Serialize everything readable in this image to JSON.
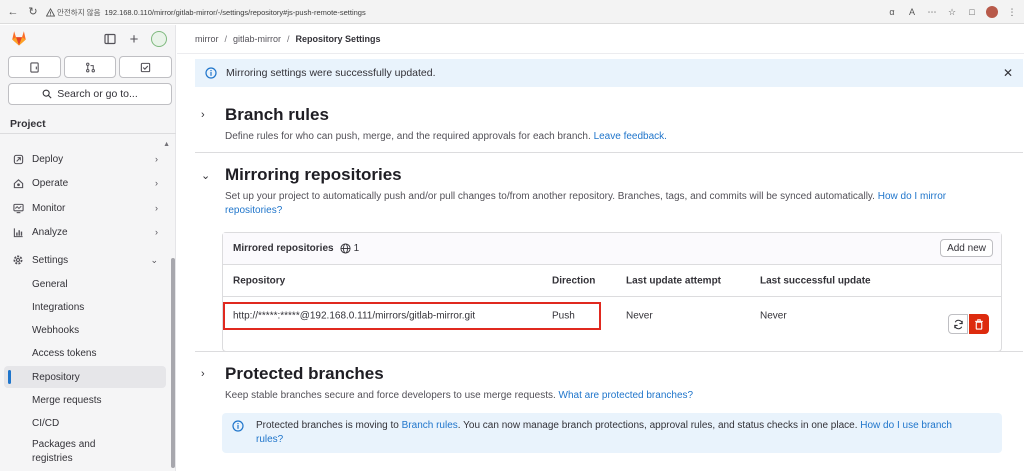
{
  "browser": {
    "secure_label": "안전하지 않음",
    "url": "192.168.0.110/mirror/gitlab-mirror/-/settings/repository#js-push-remote-settings"
  },
  "sidebar": {
    "search_label": "Search or go to...",
    "section_label": "Project",
    "nav": [
      {
        "label": "Deploy",
        "icon": "deploy-icon"
      },
      {
        "label": "Operate",
        "icon": "operate-icon"
      },
      {
        "label": "Monitor",
        "icon": "monitor-icon"
      },
      {
        "label": "Analyze",
        "icon": "analyze-icon"
      },
      {
        "label": "Settings",
        "icon": "settings-icon"
      }
    ],
    "settings_items": [
      "General",
      "Integrations",
      "Webhooks",
      "Access tokens",
      "Repository",
      "Merge requests",
      "CI/CD",
      "Packages and registries"
    ],
    "active_item": "Repository"
  },
  "breadcrumb": [
    "mirror",
    "gitlab-mirror",
    "Repository Settings"
  ],
  "alert": {
    "message": "Mirroring settings were successfully updated."
  },
  "branch_rules": {
    "title": "Branch rules",
    "description": "Define rules for who can push, merge, and the required approvals for each branch.",
    "link": "Leave feedback."
  },
  "mirroring": {
    "title": "Mirroring repositories",
    "description": "Set up your project to automatically push and/or pull changes to/from another repository. Branches, tags, and commits will be synced automatically.",
    "link_part1": "How do I mirror",
    "link_part2": "repositories?",
    "card_title": "Mirrored repositories",
    "count": "1",
    "add_new": "Add new",
    "columns": [
      "Repository",
      "Direction",
      "Last update attempt",
      "Last successful update"
    ],
    "rows": [
      {
        "repository": "http://*****:*****@192.168.0.111/mirrors/gitlab-mirror.git",
        "direction": "Push",
        "last_attempt": "Never",
        "last_success": "Never"
      }
    ]
  },
  "protected": {
    "title": "Protected branches",
    "description": "Keep stable branches secure and force developers to use merge requests.",
    "link": "What are protected branches?",
    "alert_prefix": "Protected branches is moving to",
    "alert_link1": "Branch rules",
    "alert_middle": ". You can now manage branch protections, approval rules, and status checks in one place.",
    "alert_link2_a": "How do I use branch",
    "alert_link2_b": "rules?"
  },
  "colors": {
    "accent": "#1f75cb",
    "danger": "#dd2b0e",
    "highlight": "#e0291f",
    "info_bg": "#e9f3fc"
  }
}
